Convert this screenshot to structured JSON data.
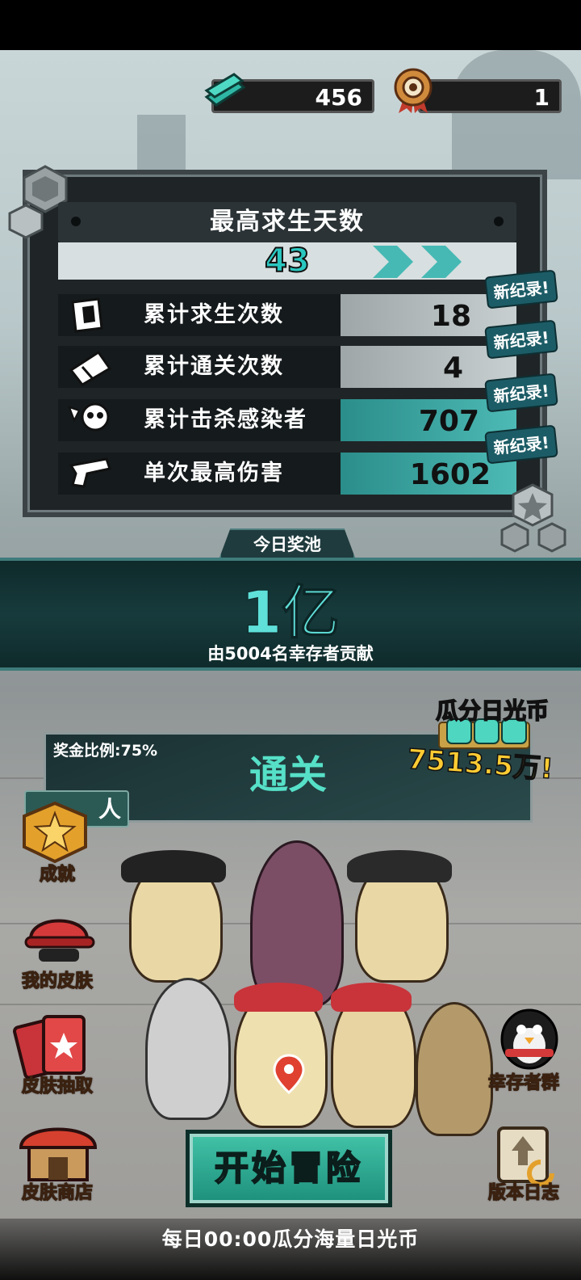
{
  "currencies": {
    "cash": "456",
    "medals": "1"
  },
  "stats": {
    "title": "最高求生天数",
    "best_days": "43",
    "rows": [
      {
        "label": "累计求生次数",
        "value": "18",
        "icon": "broken-tile-icon",
        "badge": "新纪录!"
      },
      {
        "label": "累计通关次数",
        "value": "4",
        "icon": "ticket-icon",
        "badge": "新纪录!"
      },
      {
        "label": "累计击杀感染者",
        "value": "707",
        "icon": "skull-icon",
        "badge": "新纪录!"
      },
      {
        "label": "单次最高伤害",
        "value": "1602",
        "icon": "gun-icon",
        "badge": "新纪录!"
      }
    ]
  },
  "prize_pool": {
    "tab": "今日奖池",
    "amount": "1亿",
    "contributors": "由5004名幸存者贡献"
  },
  "clear_panel": {
    "bonus_ratio": "奖金比例:75%",
    "title": "通关",
    "sun_label": "瓜分日光币",
    "sun_amount": "7513.5万!",
    "persons_tab": "人"
  },
  "side_menu": {
    "achievements": "成就",
    "my_skins": "我的皮肤",
    "skin_draw": "皮肤抽取",
    "skin_shop": "皮肤商店",
    "survivor_group": "幸存者群",
    "version_log": "版本日志"
  },
  "start_button": "开始冒险",
  "daily_note": "每日00:00瓜分海量日光币",
  "colors": {
    "teal": "#2ac7c0",
    "gold": "#ffcc33",
    "panel": "#1f2527"
  }
}
